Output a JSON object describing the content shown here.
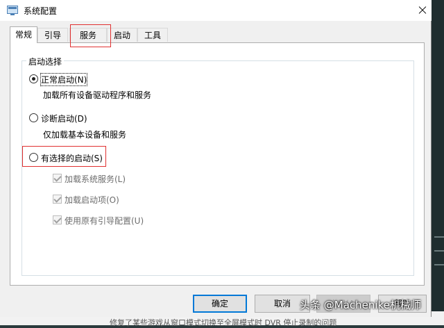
{
  "window": {
    "title": "系统配置"
  },
  "tabs": [
    {
      "label": "常规",
      "active": true
    },
    {
      "label": "引导",
      "active": false
    },
    {
      "label": "服务",
      "active": false
    },
    {
      "label": "启动",
      "active": false
    },
    {
      "label": "工具",
      "active": false
    }
  ],
  "group": {
    "legend": "启动选择",
    "normal": {
      "label": "正常启动(N)",
      "desc": "加载所有设备驱动程序和服务",
      "checked": true
    },
    "diagnostic": {
      "label": "诊断启动(D)",
      "desc": "仅加载基本设备和服务",
      "checked": false
    },
    "selective": {
      "label": "有选择的启动(S)",
      "checked": false
    },
    "options": [
      {
        "label": "加载系统服务(L)",
        "checked": true
      },
      {
        "label": "加载启动项(O)",
        "checked": true
      },
      {
        "label": "使用原有引导配置(U)",
        "checked": true
      }
    ]
  },
  "buttons": {
    "ok": "确定",
    "cancel": "取消",
    "apply": "应用(A)",
    "help": "帮助"
  },
  "background": {
    "bottom_text": "修复了某些游戏从窗口模式切换至全屏模式时 DVR 停止录制的问题"
  },
  "watermark": {
    "text": "头条 @Machenike机械师"
  },
  "colors": {
    "highlight": "#e03030",
    "primary_border": "#0078d7"
  }
}
